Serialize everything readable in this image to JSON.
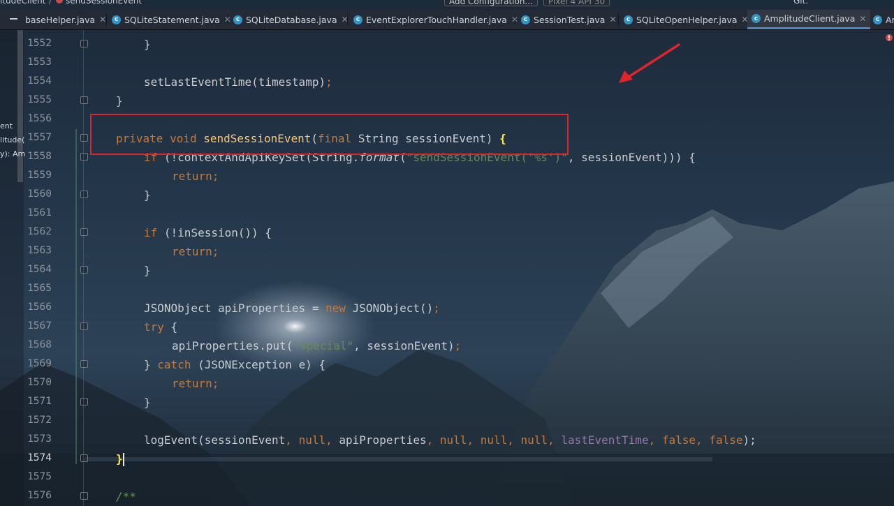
{
  "breadcrumb": {
    "class_name": "itudeClient",
    "method_name": "sendSessionEvent"
  },
  "toolbar": {
    "add_configuration": "Add Configuration...",
    "device": "Pixel 4 API 30",
    "git_label": "Git:"
  },
  "tabs": [
    {
      "label": "baseHelper.java"
    },
    {
      "label": "SQLiteStatement.java"
    },
    {
      "label": "SQLiteDatabase.java"
    },
    {
      "label": "EventExplorerTouchHandler.java"
    },
    {
      "label": "SessionTest.java"
    },
    {
      "label": "SQLiteOpenHelper.java"
    },
    {
      "label": "AmplitudeClient.java"
    },
    {
      "label": "Ar"
    }
  ],
  "left_panel": {
    "items": [
      {
        "label": "ent"
      },
      {
        "label": "litude("
      },
      {
        "label": "y): Am"
      }
    ]
  },
  "editor": {
    "current_line": "1574",
    "lines": [
      {
        "num": "1552"
      },
      {
        "num": "1553"
      },
      {
        "num": "1554"
      },
      {
        "num": "1555"
      },
      {
        "num": "1556"
      },
      {
        "num": "1557"
      },
      {
        "num": "1558"
      },
      {
        "num": "1559"
      },
      {
        "num": "1560"
      },
      {
        "num": "1561"
      },
      {
        "num": "1562"
      },
      {
        "num": "1563"
      },
      {
        "num": "1564"
      },
      {
        "num": "1565"
      },
      {
        "num": "1566"
      },
      {
        "num": "1567"
      },
      {
        "num": "1568"
      },
      {
        "num": "1569"
      },
      {
        "num": "1570"
      },
      {
        "num": "1571"
      },
      {
        "num": "1572"
      },
      {
        "num": "1573"
      },
      {
        "num": "1574"
      },
      {
        "num": "1575"
      },
      {
        "num": "1576"
      }
    ],
    "code": {
      "l1552": "}",
      "l1554_call": "setLastEventTime",
      "l1554_args": "(timestamp)",
      "l1554_semi": ";",
      "l1555": "}",
      "l1557_private": "private",
      "l1557_void": "void",
      "l1557_name": "sendSessionEvent",
      "l1557_open": "(",
      "l1557_final": "final",
      "l1557_params": "String sessionEvent)",
      "l1557_brace": "{",
      "l1558_if": "if",
      "l1558_a": "(!contextAndApiKeySet(String.",
      "l1558_format": "format",
      "l1558_b": "(",
      "l1558_str": "\"sendSessionEvent('%s')\"",
      "l1558_c": ", sessionEvent))) {",
      "l1559_return": "return",
      "l1559_semi": ";",
      "l1560": "}",
      "l1562_if": "if",
      "l1562_rest": "(!inSession()) {",
      "l1563_return": "return",
      "l1563_semi": ";",
      "l1564": "}",
      "l1566_a": "JSONObject apiProperties = ",
      "l1566_new": "new",
      "l1566_b": "JSONObject()",
      "l1566_semi": ";",
      "l1567_try": "try",
      "l1567_rest": "{",
      "l1568_a": "apiProperties.put(",
      "l1568_str": "\"special\"",
      "l1568_b": ", sessionEvent)",
      "l1568_semi": ";",
      "l1569_a": "}",
      "l1569_catch": "catch",
      "l1569_b": "(JSONException e) {",
      "l1570_return": "return",
      "l1570_semi": ";",
      "l1571": "}",
      "l1573_a": "logEvent(sessionEvent",
      "l1573_c1": ",",
      "l1573_null1": "null",
      "l1573_c2": ",",
      "l1573_b": "apiProperties",
      "l1573_c3": ",",
      "l1573_null2": "null",
      "l1573_c4": ",",
      "l1573_null3": "null",
      "l1573_c5": ",",
      "l1573_null4": "null",
      "l1573_c6": ",",
      "l1573_field": "lastEventTime",
      "l1573_c7": ",",
      "l1573_false1": "false",
      "l1573_c8": ",",
      "l1573_false2": "false",
      "l1573_end": ");",
      "l1574": "}",
      "l1576": "/**"
    }
  },
  "colors": {
    "keyword": "#cc7832",
    "function": "#ffc66d",
    "string": "#6a8759",
    "field": "#9876aa",
    "annotation_box": "#e0242b",
    "arrow": "#e0242b",
    "active_tab_underline": "#4a88c7"
  },
  "icons": {
    "tab_icon": "java-class-icon",
    "error": "error-indicator-icon"
  }
}
